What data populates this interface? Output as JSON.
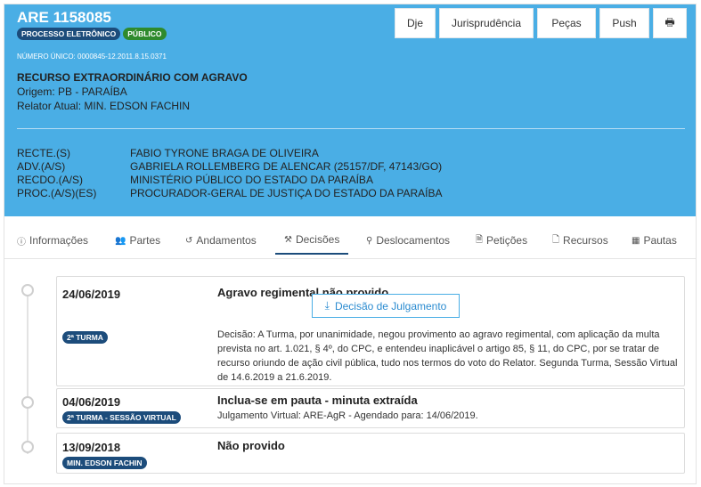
{
  "process": {
    "title": "ARE 1158085",
    "badges": [
      "PROCESSO ELETRÔNICO",
      "PÚBLICO"
    ],
    "numero_unico": "NÚMERO ÚNICO: 0000845-12.2011.8.15.0371",
    "classe": "RECURSO EXTRAORDINÁRIO COM AGRAVO",
    "origem": "Origem: PB - PARAÍBA",
    "relator": "Relator Atual: MIN. EDSON FACHIN"
  },
  "actions": [
    "Dje",
    "Jurisprudência",
    "Peças",
    "Push",
    "🖶"
  ],
  "partes": [
    {
      "role": "RECTE.(S)",
      "name": "FABIO TYRONE BRAGA DE OLIVEIRA"
    },
    {
      "role": "ADV.(A/S)",
      "name": "GABRIELA ROLLEMBERG DE ALENCAR (25157/DF, 47143/GO)"
    },
    {
      "role": "RECDO.(A/S)",
      "name": "MINISTÉRIO PÚBLICO DO ESTADO DA PARAÍBA"
    },
    {
      "role": "PROC.(A/S)(ES)",
      "name": "PROCURADOR-GERAL DE JUSTIÇA DO ESTADO DA PARAÍBA"
    }
  ],
  "tabs": [
    {
      "label": "Informações",
      "icon": "info-icon",
      "glyph": "ⓘ"
    },
    {
      "label": "Partes",
      "icon": "users-icon",
      "glyph": "👥"
    },
    {
      "label": "Andamentos",
      "icon": "history-icon",
      "glyph": "↺"
    },
    {
      "label": "Decisões",
      "icon": "gavel-icon",
      "glyph": "⚒"
    },
    {
      "label": "Deslocamentos",
      "icon": "map-marker-icon",
      "glyph": "⚲"
    },
    {
      "label": "Petições",
      "icon": "pdf-file-icon",
      "glyph": "🗎"
    },
    {
      "label": "Recursos",
      "icon": "file-icon",
      "glyph": "🗋"
    },
    {
      "label": "Pautas",
      "icon": "calendar-icon",
      "glyph": "▦"
    }
  ],
  "decisions": [
    {
      "date": "24/06/2019",
      "title": "Agravo regimental não provido",
      "badge": "2ª TURMA",
      "button": "Decisão de Julgamento",
      "text": "Decisão: A Turma, por unanimidade, negou provimento ao agravo regimental, com aplicação da multa prevista no art. 1.021, § 4º, do CPC, e entendeu inaplicável o artigo 85, § 11, do CPC, por se tratar de recurso oriundo de ação civil pública, tudo nos termos do voto do Relator. Segunda Turma, Sessão Virtual de 14.6.2019 a 21.6.2019."
    },
    {
      "date": "04/06/2019",
      "title": "Inclua-se em pauta - minuta extraída",
      "badge": "2ª TURMA - SESSÃO VIRTUAL",
      "text": "Julgamento Virtual: ARE-AgR - Agendado para: 14/06/2019."
    },
    {
      "date": "13/09/2018",
      "title": "Não provido",
      "badge": "MIN. EDSON FACHIN"
    }
  ],
  "colors": {
    "header": "#4aaee5",
    "badge_blue": "#1c4c7b",
    "badge_green": "#2f8a2d"
  }
}
